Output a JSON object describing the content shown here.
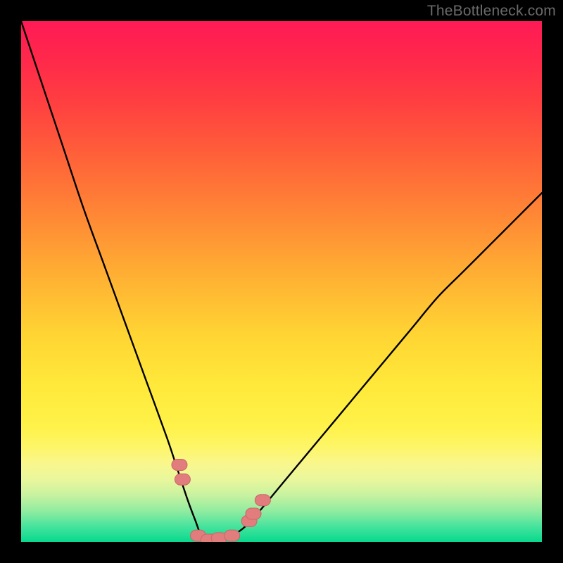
{
  "watermark": "TheBottleneck.com",
  "colors": {
    "frame": "#000000",
    "curve": "#000000",
    "marker_fill": "#e27d7d",
    "marker_stroke": "#c96666",
    "gradient_stops": [
      "#ff1a55",
      "#ff2a4a",
      "#ff4040",
      "#ff6838",
      "#ff8a35",
      "#ffad33",
      "#ffd433",
      "#ffe93a",
      "#fff24a",
      "#fdf66a",
      "#f9f78d",
      "#e9f79c",
      "#c8f2a0",
      "#92eca0",
      "#48e39d",
      "#07d98e"
    ]
  },
  "chart_data": {
    "type": "line",
    "title": "",
    "xlabel": "",
    "ylabel": "",
    "xlim": [
      0,
      100
    ],
    "ylim": [
      0,
      100
    ],
    "grid": false,
    "legend": false,
    "series": [
      {
        "name": "curve",
        "x": [
          0,
          4,
          8,
          12,
          16,
          20,
          24,
          28,
          30,
          32,
          33.5,
          34.5,
          36,
          38,
          40,
          42.5,
          45,
          50,
          55,
          60,
          65,
          70,
          75,
          80,
          85,
          90,
          95,
          100
        ],
        "y": [
          100,
          88,
          76,
          64,
          53,
          42,
          31,
          20,
          14,
          8,
          4,
          1.5,
          0.5,
          0.5,
          1,
          2.5,
          5,
          11,
          17,
          23,
          29,
          35,
          41,
          47,
          52,
          57,
          62,
          67
        ]
      }
    ],
    "markers": [
      {
        "x": 30.4,
        "y": 14.8
      },
      {
        "x": 31.0,
        "y": 12.0
      },
      {
        "x": 34.0,
        "y": 1.2
      },
      {
        "x": 36.0,
        "y": 0.4
      },
      {
        "x": 38.0,
        "y": 0.7
      },
      {
        "x": 40.5,
        "y": 1.2
      },
      {
        "x": 43.8,
        "y": 4.0
      },
      {
        "x": 44.6,
        "y": 5.4
      },
      {
        "x": 46.4,
        "y": 8.0
      }
    ],
    "annotations": []
  }
}
